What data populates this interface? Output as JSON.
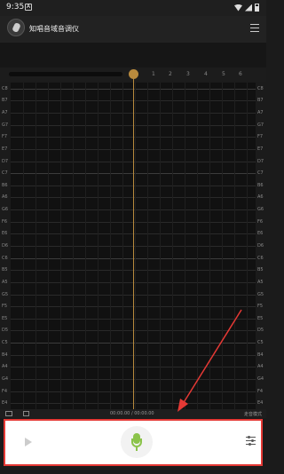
{
  "status_bar": {
    "time": "9:35",
    "notification_icon": "A"
  },
  "app_bar": {
    "title": "知唱音域音调仪"
  },
  "timeline": {
    "ticks": [
      "1",
      "2",
      "3",
      "4",
      "5",
      "6"
    ]
  },
  "note_labels": [
    "C8",
    "B7",
    "A7",
    "G7",
    "F7",
    "E7",
    "D7",
    "C7",
    "B6",
    "A6",
    "G6",
    "F6",
    "E6",
    "D6",
    "C6",
    "B5",
    "A5",
    "G5",
    "F5",
    "E5",
    "D5",
    "C5",
    "B4",
    "A4",
    "G4",
    "F4",
    "E4"
  ],
  "info_bar": {
    "time_display": "00:00.00 / 00:00.00",
    "mode_label": "走音模式"
  },
  "controls": {
    "play_icon": "play-icon",
    "mic_icon": "microphone-icon",
    "settings_icon": "settings-sliders-icon"
  },
  "colors": {
    "accent": "#b88a3d",
    "mic": "#8bc34a",
    "highlight": "#e53935"
  }
}
